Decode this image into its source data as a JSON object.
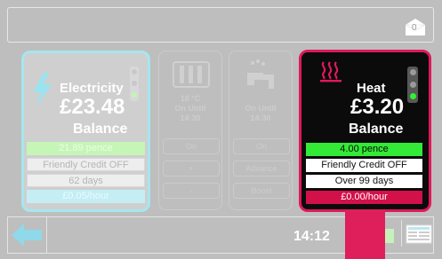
{
  "colors": {
    "electricity_border": "#a6e6ee",
    "heat_border": "#e0195a",
    "heat_background": "#0b0b0b",
    "green": "#36e83a",
    "pink": "#de1f5b",
    "red_row": "#d2104a"
  },
  "header": {
    "message_count": "0",
    "envelope_icon": "envelope-icon"
  },
  "electricity": {
    "title": "Electricity",
    "amount": "£23.48",
    "balance_label": "Balance",
    "rate": "21.89 pence",
    "credit_status": "Friendly Credit OFF",
    "days": "62 days",
    "hourly": "£0.05/hour",
    "icon": "lightning-icon"
  },
  "heating_control": {
    "temperature": "18 °C",
    "mode": "On Until",
    "time": "14:30",
    "buttons": [
      "On",
      "+",
      "-"
    ],
    "icon": "radiator-icon"
  },
  "water_control": {
    "mode": "On Until",
    "time": "14:30",
    "buttons": [
      "On",
      "Advance",
      "Boost"
    ],
    "icon": "tap-icon"
  },
  "heat": {
    "title": "Heat",
    "amount": "£3.20",
    "balance_label": "Balance",
    "rate": "4.00 pence",
    "credit_status": "Friendly Credit OFF",
    "days": "Over 99 days",
    "hourly": "£0.00/hour",
    "icon": "heat-waves-icon"
  },
  "footer": {
    "time": "14:12",
    "back_icon": "back-arrow-icon",
    "menu_icon": "menu-card-icon"
  }
}
